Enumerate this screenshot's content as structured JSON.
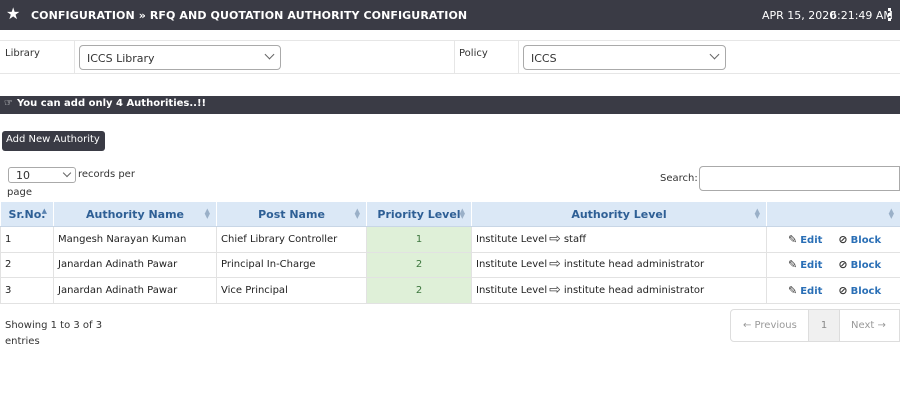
{
  "header": {
    "title": "CONFIGURATION » RFQ AND QUOTATION AUTHORITY CONFIGURATION",
    "date": "APR 15, 2020",
    "time": "6:21:49 AM"
  },
  "filters": {
    "library_label": "Library",
    "library_value": "ICCS Library",
    "policy_label": "Policy",
    "policy_value": "ICCS"
  },
  "notice": "You can add only 4 Authorities..!!",
  "add_button": "Add New Authority",
  "length": {
    "value": "10",
    "text_a": "records per",
    "text_b": "page"
  },
  "search": {
    "label": "Search:"
  },
  "table": {
    "columns": [
      "Sr.No.",
      "Authority Name",
      "Post Name",
      "Priority Level",
      "Authority Level",
      ""
    ],
    "rows": [
      {
        "sr": "1",
        "name": "Mangesh Narayan Kuman",
        "post": "Chief Library Controller",
        "priority": "1",
        "level_from": "Institute Level",
        "level_to": "staff",
        "edit": "Edit",
        "block": "Block"
      },
      {
        "sr": "2",
        "name": "Janardan Adinath Pawar",
        "post": "Principal In-Charge",
        "priority": "2",
        "level_from": "Institute Level",
        "level_to": "institute head administrator",
        "edit": "Edit",
        "block": "Block"
      },
      {
        "sr": "3",
        "name": "Janardan Adinath Pawar",
        "post": "Vice Principal",
        "priority": "2",
        "level_from": "Institute Level",
        "level_to": "institute head administrator",
        "edit": "Edit",
        "block": "Block"
      }
    ]
  },
  "info": {
    "line1": "Showing 1 to 3 of 3",
    "line2": "entries"
  },
  "pager": {
    "prev": "← Previous",
    "current": "1",
    "next": "Next →"
  },
  "colors": {
    "header_bg": "#3a3b45",
    "th_bg": "#dbe8f6",
    "th_text": "#2e5f95",
    "priority_bg": "#dff0d8",
    "link": "#2a6fb6"
  },
  "icons": [
    "star-icon",
    "kebab-menu-icon",
    "hand-pointer-icon",
    "chevron-down-icon",
    "sort-icon",
    "arrow-right-icon",
    "pencil-icon",
    "block-icon"
  ]
}
